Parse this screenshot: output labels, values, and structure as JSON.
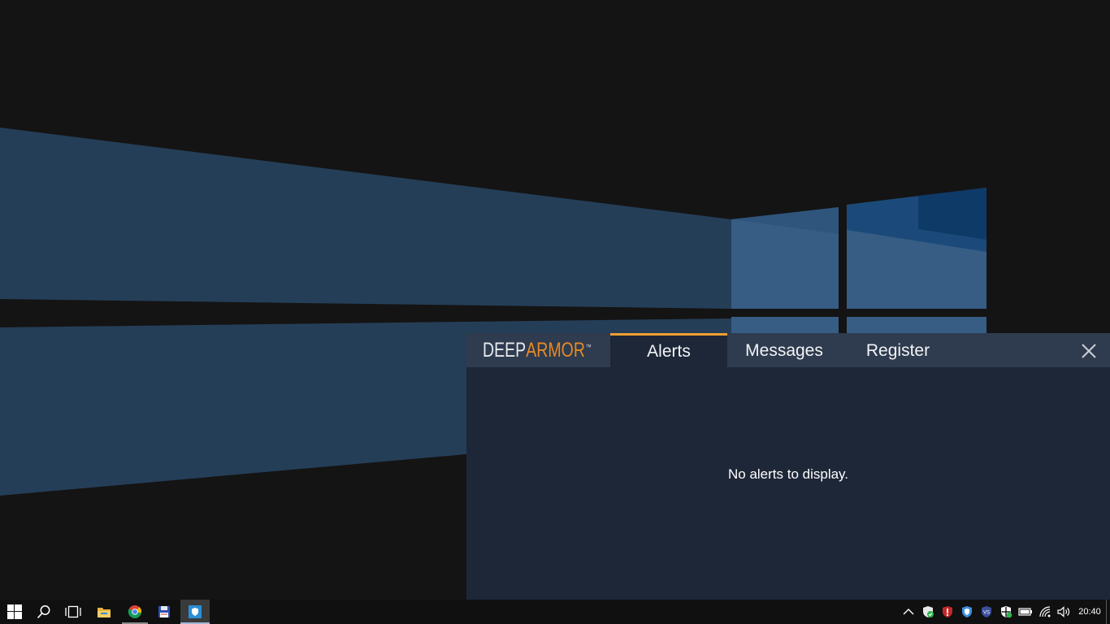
{
  "popup": {
    "logo": {
      "part1": "DEEP",
      "part2": "ARMOR",
      "trademark": "™"
    },
    "tabs": [
      {
        "label": "Alerts",
        "active": true
      },
      {
        "label": "Messages",
        "active": false
      },
      {
        "label": "Register",
        "active": false
      }
    ],
    "empty_message": "No alerts to display.",
    "accent_color": "#e58a25",
    "active_tab_color": "#f0a030"
  },
  "taskbar": {
    "clock": "20:40",
    "pinned": [
      "windows-start-icon",
      "search-icon",
      "task-view-icon",
      "file-explorer-icon",
      "chrome-icon",
      "floppy-disk-app-icon",
      "deeparmor-app-icon"
    ],
    "tray": [
      "show-hidden-icons-chevron",
      "shield-check-icon",
      "antivirus-shield-icon",
      "security-shield-icon",
      "vs-icon",
      "windows-defender-icon",
      "battery-icon",
      "wifi-icon",
      "volume-icon"
    ]
  }
}
